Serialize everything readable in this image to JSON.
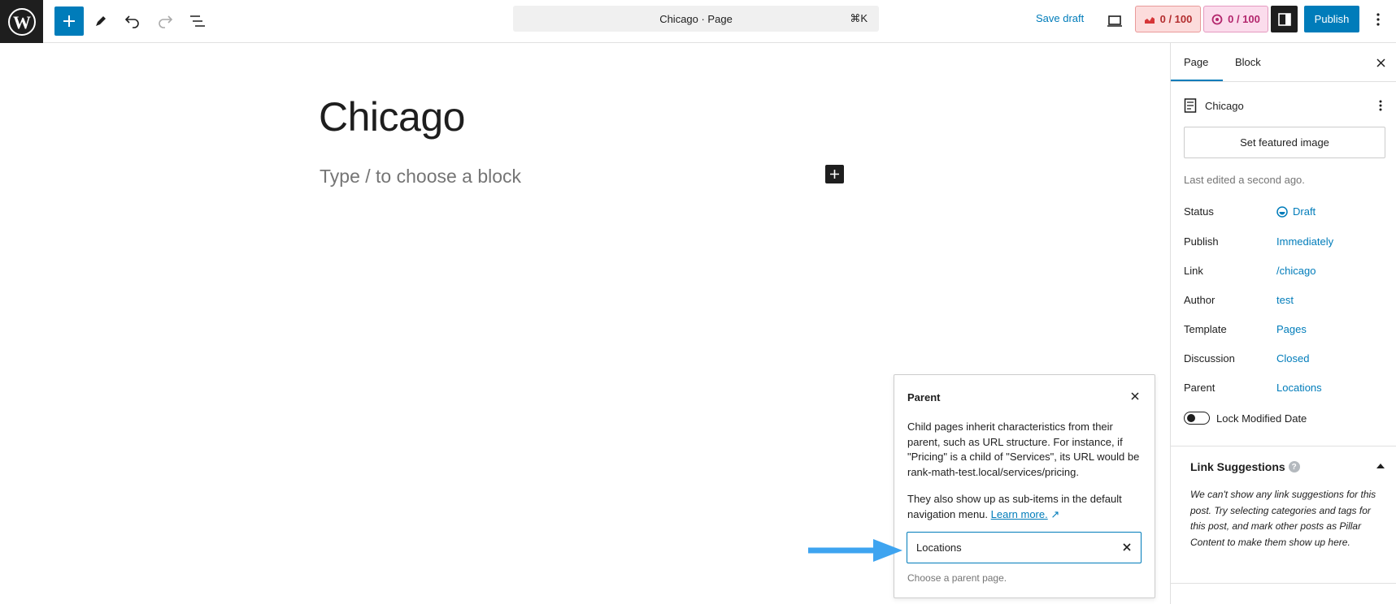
{
  "header": {
    "document_title": "Chicago · Page",
    "shortcut": "⌘K",
    "save_draft": "Save draft",
    "seo_score_1": "0 / 100",
    "seo_score_2": "0 / 100",
    "publish": "Publish"
  },
  "editor": {
    "title": "Chicago",
    "placeholder": "Type / to choose a block"
  },
  "popover": {
    "title": "Parent",
    "description": "Child pages inherit characteristics from their parent, such as URL structure. For instance, if \"Pricing\" is a child of \"Services\", its URL would be rank-math-test.local/services/pricing.",
    "description2": "They also show up as sub-items in the default navigation menu.",
    "learn_more": "Learn more.",
    "input_value": "Locations",
    "help": "Choose a parent page."
  },
  "sidebar": {
    "tabs": [
      "Page",
      "Block"
    ],
    "document_name": "Chicago",
    "featured_image": "Set featured image",
    "last_edited": "Last edited a second ago.",
    "meta": [
      {
        "label": "Status",
        "value": "Draft"
      },
      {
        "label": "Publish",
        "value": "Immediately"
      },
      {
        "label": "Link",
        "value": "/chicago"
      },
      {
        "label": "Author",
        "value": "test"
      },
      {
        "label": "Template",
        "value": "Pages"
      },
      {
        "label": "Discussion",
        "value": "Closed"
      },
      {
        "label": "Parent",
        "value": "Locations"
      }
    ],
    "lock_modified": "Lock Modified Date",
    "link_suggestions": {
      "title": "Link Suggestions",
      "help": "?",
      "text": "We can't show any link suggestions for this post. Try selecting categories and tags for this post, and mark other posts as Pillar Content to make them show up here."
    }
  },
  "colors": {
    "accent": "#007cba",
    "dark": "#1e1e1e",
    "annotation_arrow": "#3ea4f0"
  }
}
